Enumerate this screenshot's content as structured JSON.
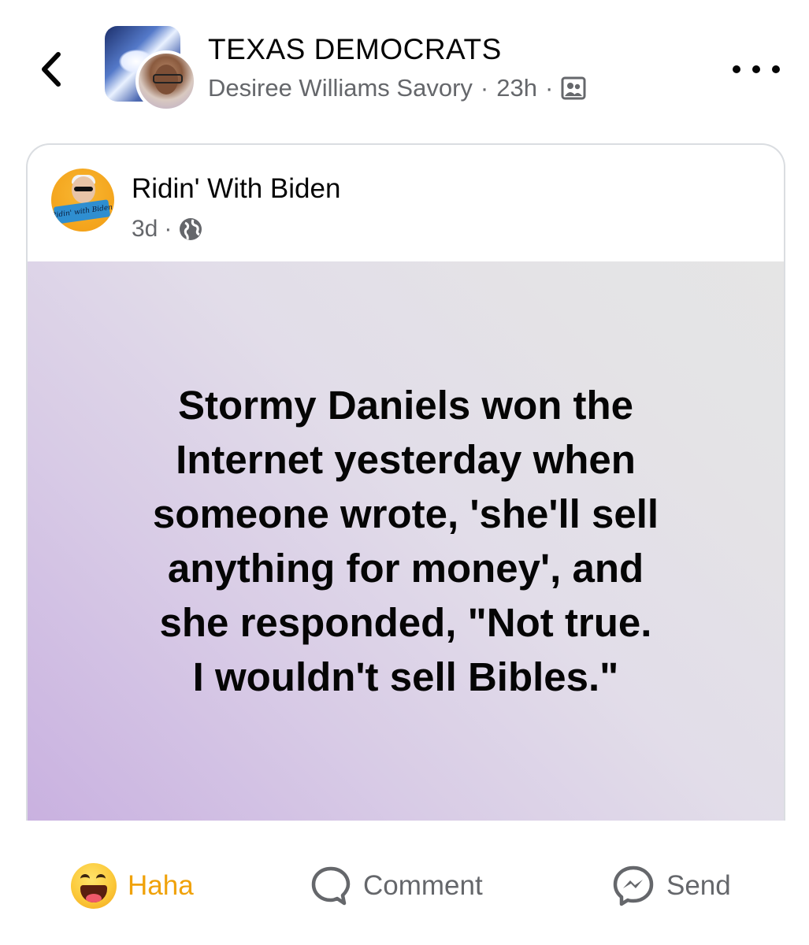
{
  "header": {
    "group_name": "TEXAS DEMOCRATS",
    "author": "Desiree Williams Savory",
    "separator": "·",
    "time": "23h",
    "privacy_icon": "group-members-icon",
    "back_icon": "chevron-left-icon",
    "more_icon": "more-options-icon"
  },
  "shared_post": {
    "page_name": "Ridin' With Biden",
    "page_avatar_text": "Ridin' with Biden",
    "time": "3d",
    "separator": "·",
    "audience_icon": "globe-icon",
    "text": "Stormy Daniels won the\nInternet yesterday when\nsomeone wrote, 'she'll sell\nanything for money', and\nshe responded, \"Not true.\nI wouldn't sell Bibles.\""
  },
  "actions": {
    "reaction_label": "Haha",
    "reaction_icon": "haha-emoji-icon",
    "comment_label": "Comment",
    "comment_icon": "comment-bubble-icon",
    "send_label": "Send",
    "send_icon": "messenger-icon"
  },
  "colors": {
    "reaction_active": "#f0a20a",
    "secondary_text": "#65676b",
    "primary_text": "#050505"
  }
}
